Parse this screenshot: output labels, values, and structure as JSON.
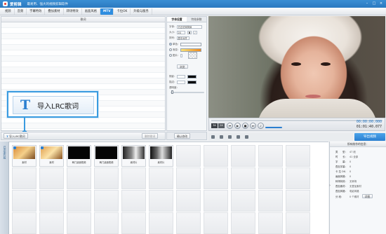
{
  "titlebar": {
    "app_name": "爱剪辑",
    "slogan": "最易用、强大的视频剪辑软件",
    "min": "–",
    "max": "□",
    "close": "×"
  },
  "menu": [
    "视频",
    "音频",
    "字幕特效",
    "叠加素材",
    "转场特效",
    "画面风格",
    "MTV",
    "卡拉OK",
    "升级与服务"
  ],
  "menu_active": "MTV",
  "lyric_panel": {
    "header": "歌词",
    "import_button": "导入LRC歌词",
    "delete_button": "删除歌词",
    "confirm_button": "确认修改"
  },
  "callout": {
    "text": "导入LRC歌词"
  },
  "settings": {
    "tab_style": "字体设置",
    "tab_effect": "特效参数",
    "font_label": "字体：",
    "font_value": "方正仿宋简体",
    "size_label": "大小：",
    "size_value": "20",
    "bold": "B",
    "italic": "I",
    "align_label": "排列：",
    "align_value": "居中对齐",
    "color_label": "单色：",
    "gradient_label": "渐变：",
    "image_label": "图片：",
    "shadow_label": "阴影：",
    "stroke_label": "描边：",
    "opacity_label": "透明度：",
    "browse": "浏览"
  },
  "player": {
    "time_current": "00:00:00.000",
    "time_total": "01:01:40.077",
    "zoom_a": "3X",
    "zoom_b": "2X"
  },
  "export_button": "导出视频",
  "storyboard": {
    "tab": "已添加片段",
    "clips": [
      {
        "label": "素材"
      },
      {
        "label": "素材"
      },
      {
        "label": "两门桌面视频"
      },
      {
        "label": "两门桌面视频"
      },
      {
        "label": "素材片"
      },
      {
        "label": "素材片"
      }
    ]
  },
  "info": {
    "title": "所有制作的信息：",
    "rows": [
      {
        "k": "类　　型：",
        "v": "47 段"
      },
      {
        "k": "时　　长：",
        "v": "41 全部"
      },
      {
        "k": "字　　幕：",
        "v": "0"
      },
      {
        "k": "叠加字幕：",
        "v": "0"
      },
      {
        "k": "卡 拉 OK：",
        "v": "0"
      },
      {
        "k": "画面风格：",
        "v": "0"
      },
      {
        "k": "转场特效：",
        "v": "无转场"
      },
      {
        "k": "叠加素材：",
        "v": "无叠加素材"
      },
      {
        "k": "叠加风格：",
        "v": "电影风格"
      },
      {
        "k": "分 段：",
        "v": "0 个素材"
      },
      {
        "k": "",
        "v": "详细"
      }
    ]
  },
  "colors": {
    "accent": "#2f8ee0",
    "titlebar": "#2a79c0"
  }
}
